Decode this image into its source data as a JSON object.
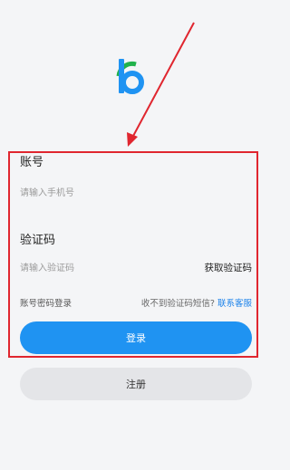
{
  "form": {
    "account_label": "账号",
    "phone_placeholder": "请输入手机号",
    "phone_value": "",
    "code_label": "验证码",
    "code_placeholder": "请输入验证码",
    "code_value": "",
    "get_code_label": "获取验证码",
    "password_login_label": "账号密码登录",
    "no_code_text": "收不到验证码短信?",
    "contact_service_label": "联系客服",
    "login_label": "登录",
    "register_label": "注册"
  },
  "colors": {
    "primary": "#1f93f2",
    "link": "#1b82ea",
    "logo_blue": "#1f93f2",
    "logo_green": "#21b24b",
    "annotation": "#e0262f"
  },
  "icons": {
    "logo": "app-logo",
    "annotation": "red-arrow"
  }
}
